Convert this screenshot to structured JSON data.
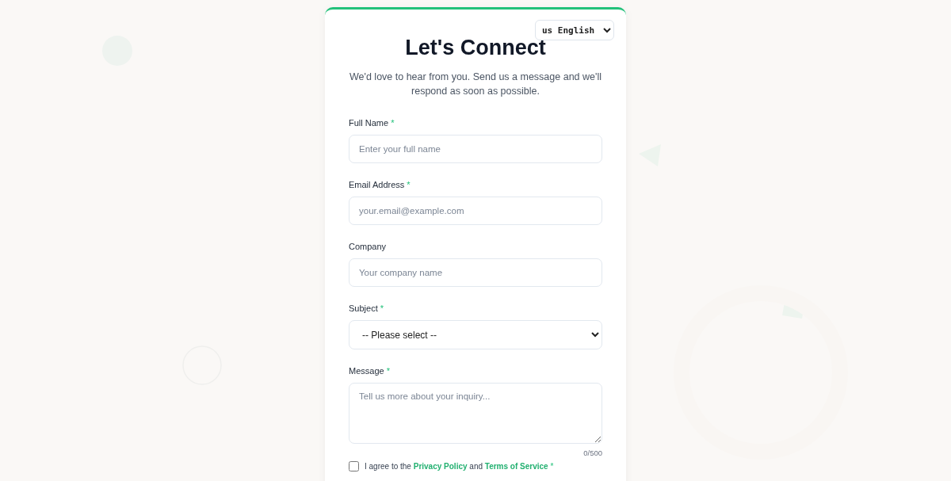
{
  "language_select": {
    "value": "us English"
  },
  "title": "Let's Connect",
  "subtitle": "We'd love to hear from you. Send us a message and we'll respond as soon as possible.",
  "fields": [
    {
      "kind": "text",
      "label": "Full Name",
      "required_mark": "*",
      "placeholder": "Enter your full name"
    },
    {
      "kind": "text",
      "label": "Email Address",
      "required_mark": "*",
      "placeholder": "your.email@example.com"
    },
    {
      "kind": "text",
      "label": "Company",
      "placeholder": "Your company name"
    },
    {
      "kind": "select",
      "label": "Subject",
      "required_mark": "*",
      "value": "-- Please select --"
    },
    {
      "kind": "textarea",
      "label": "Message",
      "required_mark": "*",
      "placeholder": "Tell us more about your inquiry...",
      "counter": "0/500"
    }
  ],
  "consent": {
    "checked": false,
    "text_before": "I agree to the",
    "link_1": "Privacy Policy",
    "text_between": "and",
    "link_2": "Terms of Service",
    "required_mark": "*"
  }
}
